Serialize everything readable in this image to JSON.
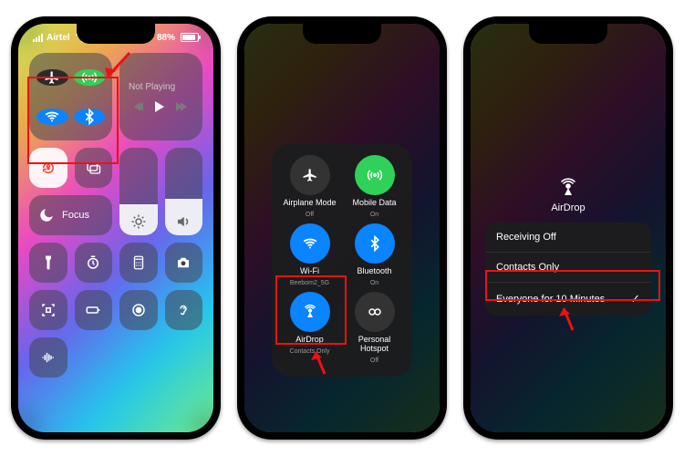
{
  "status": {
    "carrier": "Airtel",
    "battery": "88%"
  },
  "media_not_playing": "Not Playing",
  "focus_label": "Focus",
  "connectivity": {
    "airplane": {
      "label": "Airplane Mode",
      "status": "Off"
    },
    "mobile": {
      "label": "Mobile Data",
      "status": "On"
    },
    "wifi": {
      "label": "Wi-Fi",
      "status": "Beebom2_5G"
    },
    "bluetooth": {
      "label": "Bluetooth",
      "status": "On"
    },
    "airdrop": {
      "label": "AirDrop",
      "status": "Contacts Only"
    },
    "hotspot": {
      "label": "Personal Hotspot",
      "status": "Off"
    }
  },
  "airdrop_menu": {
    "title": "AirDrop",
    "options": [
      "Receiving Off",
      "Contacts Only",
      "Everyone for 10 Minutes"
    ],
    "selected_index": 2
  }
}
